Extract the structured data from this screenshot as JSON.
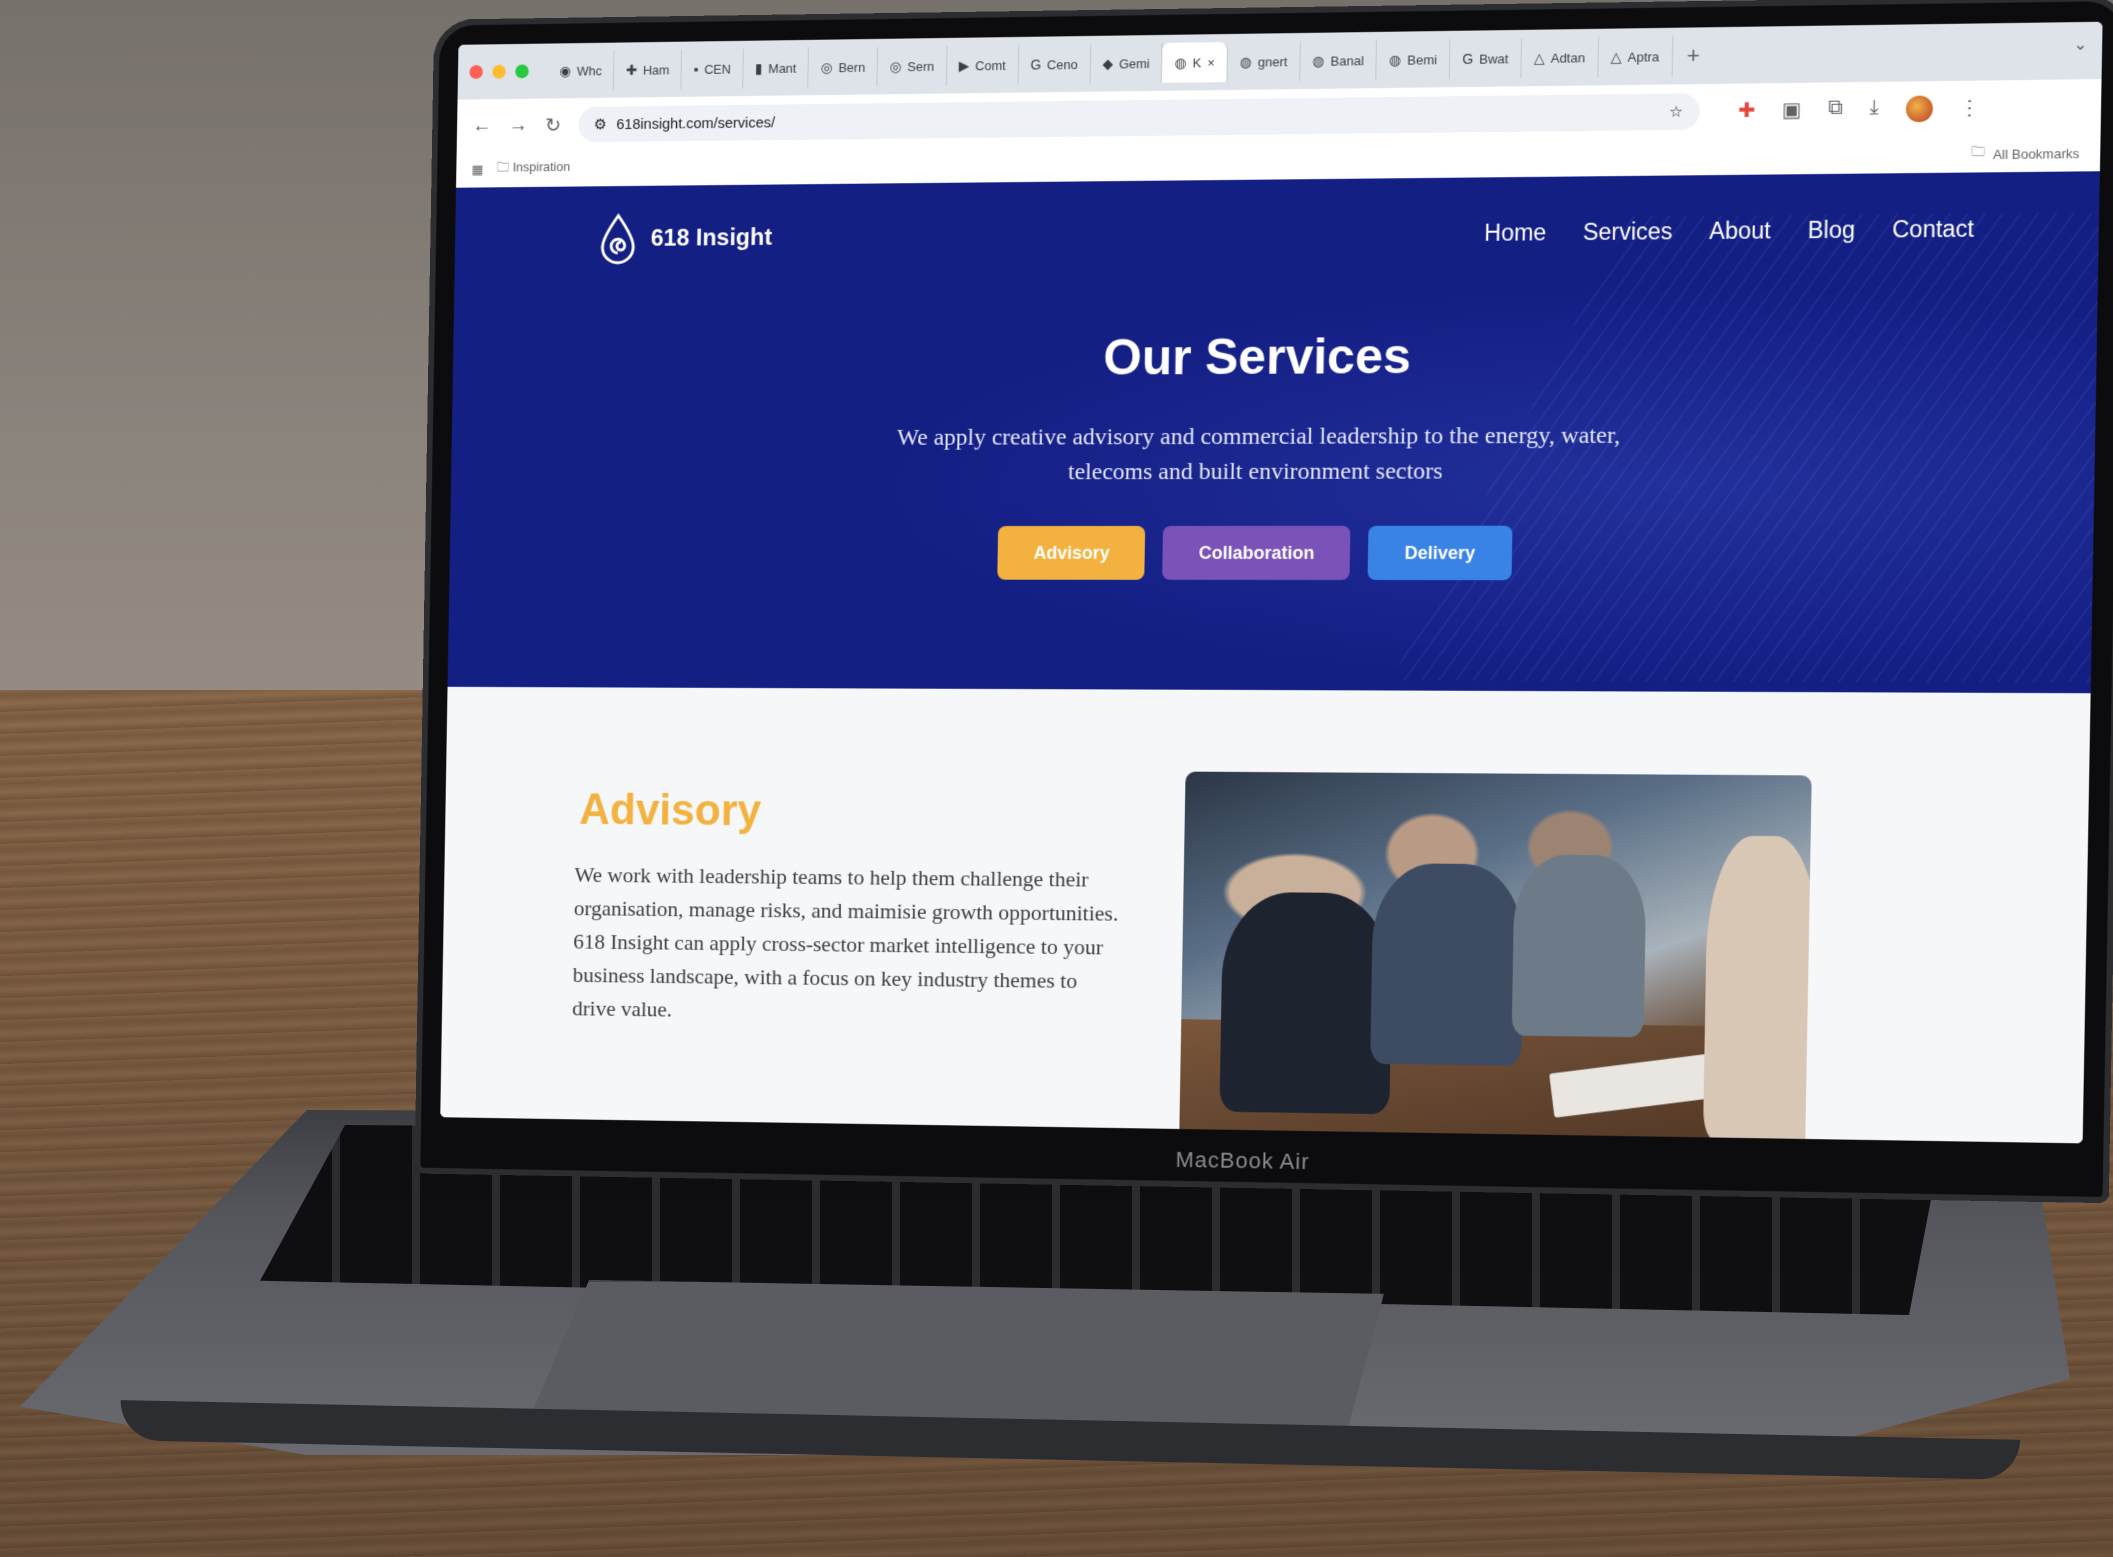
{
  "colors": {
    "hero_bg": "#141f84",
    "advisory": "#f3b23f",
    "collaboration": "#7a52b8",
    "delivery": "#3a83e6"
  },
  "browser": {
    "tabs": [
      {
        "icon": "chrome-icon",
        "label": "Whc"
      },
      {
        "icon": "figma-icon",
        "label": "Ham"
      },
      {
        "icon": "linkedin-icon",
        "label": "CEN"
      },
      {
        "icon": "bookmark-icon",
        "label": "Mant"
      },
      {
        "icon": "circle-icon",
        "label": "Bern"
      },
      {
        "icon": "circle-icon",
        "label": "Sern"
      },
      {
        "icon": "youtube-icon",
        "label": "Comt"
      },
      {
        "icon": "google-icon",
        "label": "Ceno"
      },
      {
        "icon": "gemini-icon",
        "label": "Gemi"
      },
      {
        "icon": "globe-icon",
        "label": "K"
      },
      {
        "icon": "globe-icon",
        "label": "gnert"
      },
      {
        "icon": "globe-icon",
        "label": "Banal"
      },
      {
        "icon": "globe-icon",
        "label": "Bemi"
      },
      {
        "icon": "google-icon",
        "label": "Bwat"
      },
      {
        "icon": "triangle-icon",
        "label": "Adtan"
      },
      {
        "icon": "triangle-icon",
        "label": "Aptra"
      }
    ],
    "url": "618insight.com/services/",
    "bookmark_folder": "Inspiration",
    "all_bookmarks": "All Bookmarks"
  },
  "site": {
    "logo_text": "618 Insight",
    "nav": [
      "Home",
      "Services",
      "About",
      "Blog",
      "Contact"
    ],
    "hero_title": "Our Services",
    "hero_subtitle": "We apply creative advisory and commercial leadership to the energy, water, telecoms and built environment sectors",
    "pills": [
      "Advisory",
      "Collaboration",
      "Delivery"
    ],
    "section_title": "Advisory",
    "section_body": "We work with leadership teams to help them challenge their organisation, manage risks, and maimisie growth opportunities. 618 Insight can apply cross-sector market intelligence to your business landscape, with a focus on key industry themes to drive value."
  },
  "laptop_label": "MacBook Air"
}
